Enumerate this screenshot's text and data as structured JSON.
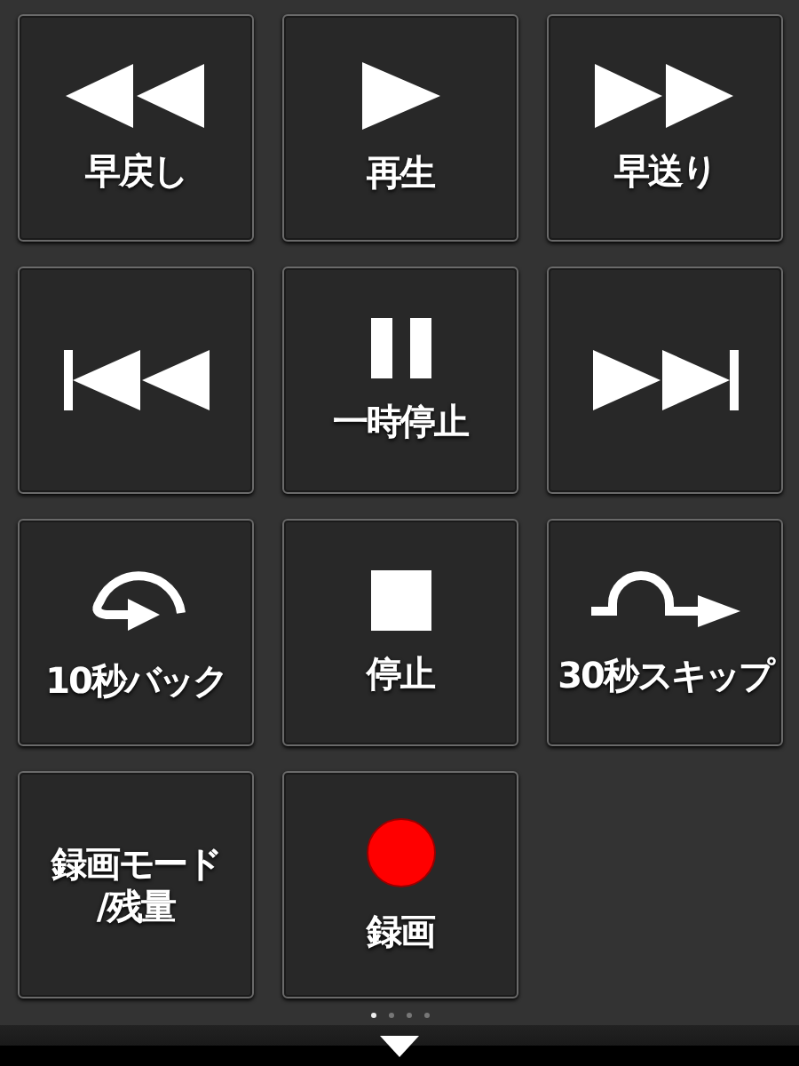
{
  "buttons": [
    {
      "kind": "rewind",
      "label": "早戻し"
    },
    {
      "kind": "play",
      "label": "再生"
    },
    {
      "kind": "fast_forward",
      "label": "早送り"
    },
    {
      "kind": "previous"
    },
    {
      "kind": "pause",
      "label": "一時停止"
    },
    {
      "kind": "next"
    },
    {
      "kind": "back10",
      "label": "10秒バック"
    },
    {
      "kind": "stop",
      "label": "停止"
    },
    {
      "kind": "skip30",
      "label": "30秒スキップ"
    },
    {
      "kind": "text",
      "label": "録画モード\n/残量"
    },
    {
      "kind": "record",
      "label": "録画"
    }
  ],
  "page_dots": [
    {
      "selected": true
    },
    {
      "selected": false
    },
    {
      "selected": false
    },
    {
      "selected": false
    }
  ]
}
